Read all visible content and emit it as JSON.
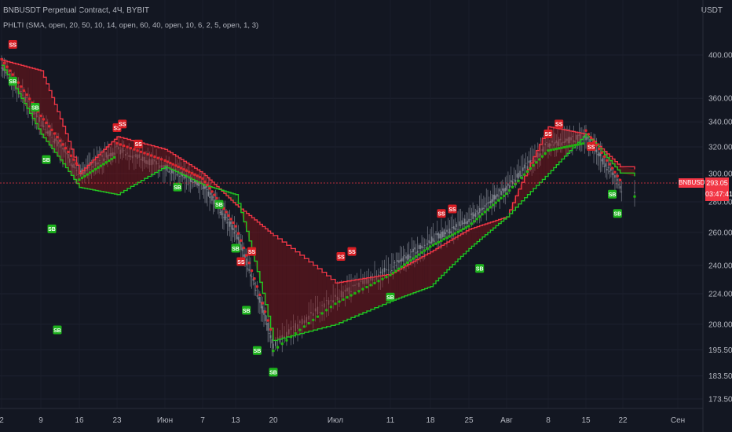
{
  "header": {
    "symbol_line": "BNBUSDT Perpetual Contract, 4Ч, BYBIT",
    "indicator_line": "PHLTI (SMA, open, 20, 50, 10, 14, open, 60, 40, open, 10, 6, 2, 5, open, 1, 3)"
  },
  "price_scale": {
    "unit": "USDT",
    "ticks": [
      "400.00",
      "360.00",
      "340.00",
      "320.00",
      "300.00",
      "280.00",
      "260.00",
      "240.00",
      "224.00",
      "208.00",
      "195.50",
      "183.50",
      "173.50"
    ],
    "current_symbol": "BNBUSDT",
    "current_price": "293.05",
    "countdown": "03:47:41"
  },
  "colors": {
    "background": "#131722",
    "upper_line": "#f23645",
    "lower_line": "#22c522",
    "green_dots": "#1fb50f",
    "red_dots": "#e0272f",
    "sb_label_bg": "#1db31d",
    "ss_label_bg": "#d81e24",
    "price_tag": "#f23645",
    "candle_wick": "#8a8e99"
  },
  "time_axis": [
    "2",
    "9",
    "16",
    "23",
    "Июн",
    "7",
    "13",
    "20",
    "Июл",
    "11",
    "18",
    "25",
    "Авг",
    "8",
    "15",
    "22",
    "Сен"
  ],
  "chart_data": {
    "type": "line",
    "title": "BNBUSDT Perpetual Contract, 4Ч, BYBIT",
    "y_scale": "log",
    "ylim": [
      170,
      450
    ],
    "x": [
      "May 2",
      "May 9",
      "May 16",
      "May 23",
      "Jun 1",
      "Jun 7",
      "Jun 13",
      "Jun 20",
      "Jul 1",
      "Jul 11",
      "Jul 18",
      "Jul 25",
      "Aug 1",
      "Aug 8",
      "Aug 15",
      "Aug 22",
      "Sep 1"
    ],
    "series": [
      {
        "name": "upper_band",
        "values": [
          395,
          385,
          300,
          328,
          318,
          300,
          278,
          258,
          230,
          235,
          248,
          262,
          270,
          336,
          330,
          303,
          null
        ]
      },
      {
        "name": "lower_band",
        "values": [
          390,
          330,
          290,
          285,
          305,
          292,
          285,
          200,
          208,
          220,
          228,
          250,
          270,
          300,
          330,
          298,
          null
        ]
      },
      {
        "name": "price",
        "values": [
          390,
          340,
          300,
          318,
          305,
          292,
          260,
          198,
          222,
          238,
          255,
          268,
          290,
          322,
          328,
          288,
          null
        ]
      }
    ],
    "annotations": {
      "SS_label": "SS",
      "SB_label": "SB",
      "ss_points": [
        {
          "x": "May 4",
          "y": 410
        },
        {
          "x": "May 23",
          "y": 335
        },
        {
          "x": "May 24",
          "y": 338
        },
        {
          "x": "May 27",
          "y": 322
        },
        {
          "x": "Jun 14",
          "y": 242
        },
        {
          "x": "Jun 16",
          "y": 248
        },
        {
          "x": "Jul 2",
          "y": 245
        },
        {
          "x": "Jul 4",
          "y": 248
        },
        {
          "x": "Jul 20",
          "y": 272
        },
        {
          "x": "Jul 22",
          "y": 275
        },
        {
          "x": "Aug 8",
          "y": 330
        },
        {
          "x": "Aug 10",
          "y": 338
        },
        {
          "x": "Aug 16",
          "y": 320
        }
      ],
      "sb_points": [
        {
          "x": "May 4",
          "y": 375
        },
        {
          "x": "May 8",
          "y": 352
        },
        {
          "x": "May 10",
          "y": 310
        },
        {
          "x": "May 11",
          "y": 262
        },
        {
          "x": "May 12",
          "y": 205
        },
        {
          "x": "Jun 3",
          "y": 290
        },
        {
          "x": "Jun 10",
          "y": 278
        },
        {
          "x": "Jun 13",
          "y": 250
        },
        {
          "x": "Jun 15",
          "y": 215
        },
        {
          "x": "Jun 17",
          "y": 195
        },
        {
          "x": "Jun 20",
          "y": 185
        },
        {
          "x": "Jul 11",
          "y": 222
        },
        {
          "x": "Jul 27",
          "y": 238
        },
        {
          "x": "Aug 20",
          "y": 285
        },
        {
          "x": "Aug 21",
          "y": 272
        }
      ]
    }
  }
}
